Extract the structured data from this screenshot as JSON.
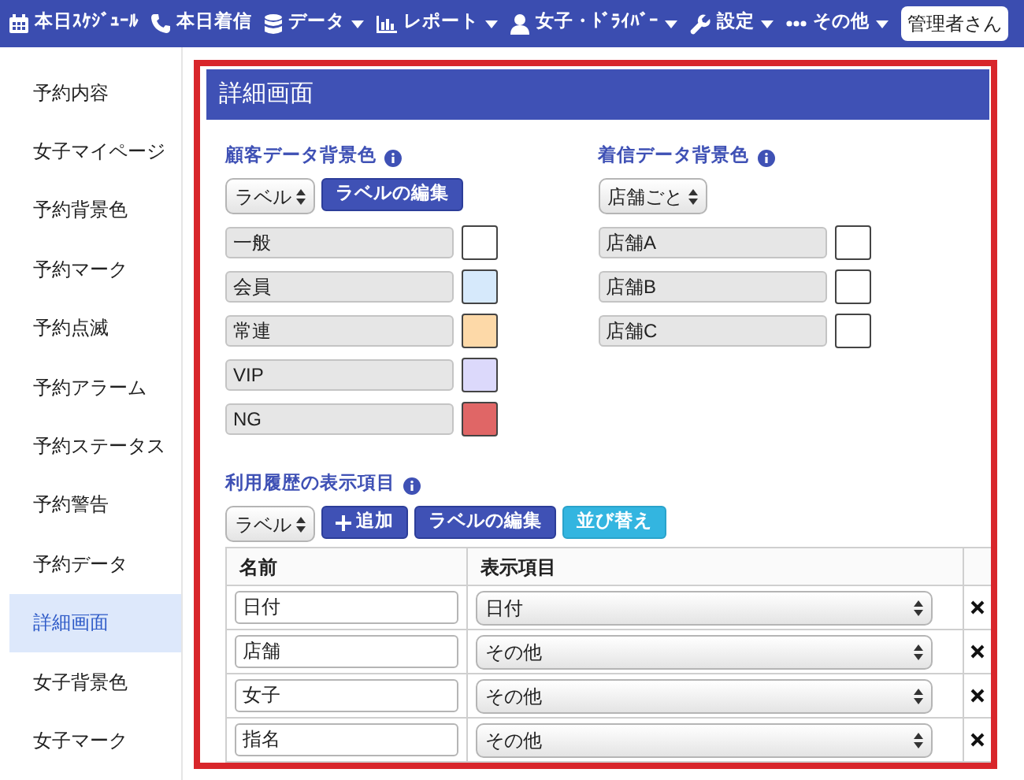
{
  "navbar": {
    "items": [
      {
        "label": "本日ｽｹｼﾞｭｰﾙ",
        "dropdown": false
      },
      {
        "label": "本日着信",
        "dropdown": false
      },
      {
        "label": "データ",
        "dropdown": true
      },
      {
        "label": "レポート",
        "dropdown": true
      },
      {
        "label": "女子・ﾄﾞﾗｲﾊﾞｰ",
        "dropdown": true
      },
      {
        "label": "設定",
        "dropdown": true
      },
      {
        "label": "その他",
        "dropdown": true
      }
    ],
    "user_button": "管理者さん"
  },
  "sidebar": {
    "items": [
      {
        "label": "予約内容",
        "selected": false
      },
      {
        "label": "女子マイページ",
        "selected": false
      },
      {
        "label": "予約背景色",
        "selected": false
      },
      {
        "label": "予約マーク",
        "selected": false
      },
      {
        "label": "予約点滅",
        "selected": false
      },
      {
        "label": "予約アラーム",
        "selected": false
      },
      {
        "label": "予約ステータス",
        "selected": false
      },
      {
        "label": "予約警告",
        "selected": false
      },
      {
        "label": "予約データ",
        "selected": false
      },
      {
        "label": "詳細画面",
        "selected": true
      },
      {
        "label": "女子背景色",
        "selected": false
      },
      {
        "label": "女子マーク",
        "selected": false
      }
    ]
  },
  "panel": {
    "title": "詳細画面",
    "customer_bg": {
      "title": "顧客データ背景色",
      "select": "ラベル",
      "edit_button": "ラベルの編集",
      "rows": [
        {
          "label": "一般",
          "color": "#ffffff"
        },
        {
          "label": "会員",
          "color": "#d6e9fb"
        },
        {
          "label": "常連",
          "color": "#fdd9a8"
        },
        {
          "label": "VIP",
          "color": "#dcd9fb"
        },
        {
          "label": "NG",
          "color": "#e06666"
        }
      ]
    },
    "incoming_bg": {
      "title": "着信データ背景色",
      "select": "店舗ごと",
      "rows": [
        {
          "label": "店舗A",
          "color": "#ffffff"
        },
        {
          "label": "店舗B",
          "color": "#ffffff"
        },
        {
          "label": "店舗C",
          "color": "#ffffff"
        }
      ]
    },
    "history": {
      "title": "利用履歴の表示項目",
      "select": "ラベル",
      "add_button": "追加",
      "edit_button": "ラベルの編集",
      "sort_button": "並び替え",
      "table": {
        "columns": [
          "名前",
          "表示項目"
        ],
        "rows": [
          {
            "name": "日付",
            "item": "日付"
          },
          {
            "name": "店舗",
            "item": "その他"
          },
          {
            "name": "女子",
            "item": "その他"
          },
          {
            "name": "指名",
            "item": "その他"
          }
        ]
      }
    }
  }
}
